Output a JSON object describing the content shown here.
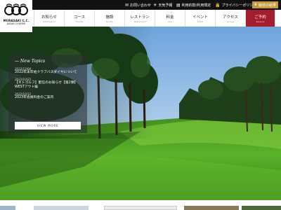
{
  "logo": {
    "text_en": "MURASAKI C.C.",
    "text_sub": "ASAHI COURSE"
  },
  "topbar": {
    "contact": "お問い合わせ",
    "weather": "天気予報",
    "terms": "利用約款/利用規定",
    "privacy": "プライバシーポリシー",
    "lang": "競技の結果"
  },
  "nav": [
    {
      "jp": "お知らせ",
      "en": "Information"
    },
    {
      "jp": "コース",
      "en": "Course"
    },
    {
      "jp": "施設",
      "en": "Facility"
    },
    {
      "jp": "レストラン",
      "en": "Restaurant"
    },
    {
      "jp": "料金",
      "en": "Fee"
    },
    {
      "jp": "イベント",
      "en": "Event"
    },
    {
      "jp": "アクセス",
      "en": "Access"
    },
    {
      "jp": "ご予約",
      "en": "Reserve"
    }
  ],
  "topics": {
    "title": "— New Topics",
    "items": [
      {
        "date": "2022/12/04",
        "text": "2022年末年始クラブバスダイヤについて"
      },
      {
        "date": "2022/10/23",
        "text": "【ネトゴルフ】配信のお知らせ【第2弾】WESTアウト編"
      },
      {
        "date": "2022/10/12",
        "text": "2023年会員料金のご案内"
      }
    ],
    "view_more": "VIEW MORE"
  },
  "colors": {
    "accent_red": "#a31d2c",
    "gold": "#c79a3a",
    "topbar": "#111111"
  }
}
